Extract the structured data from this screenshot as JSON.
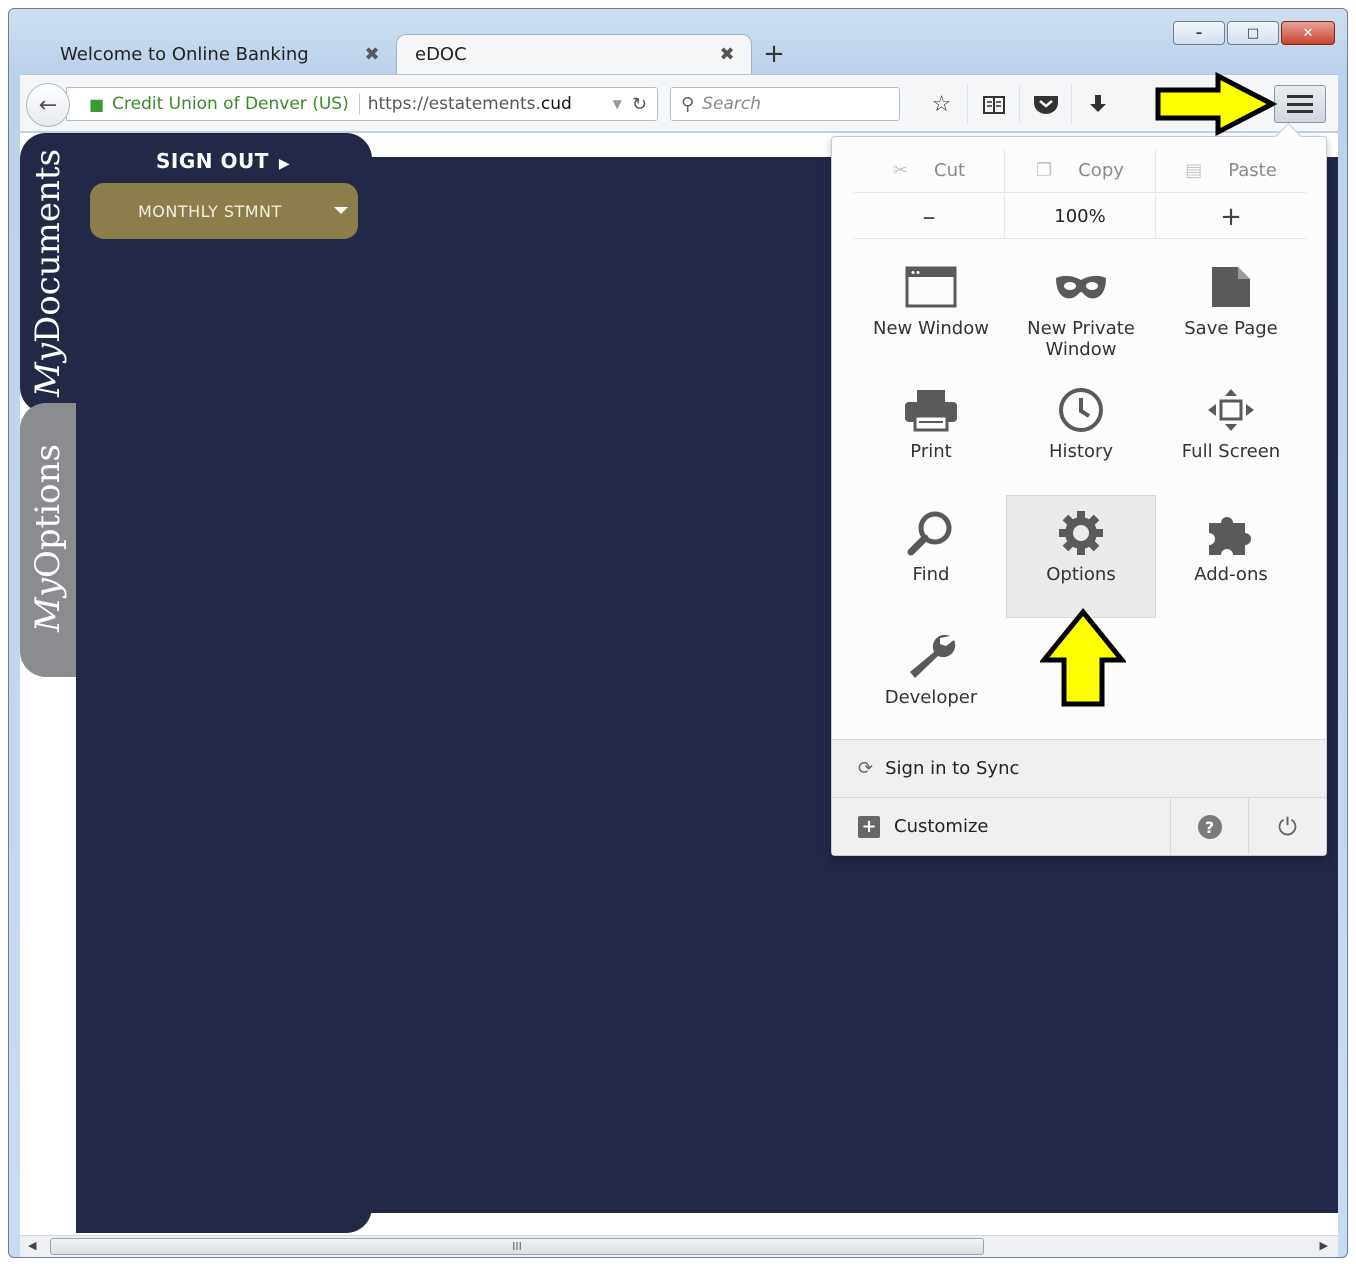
{
  "window": {
    "controls": {
      "minimize": "–",
      "maximize": "□",
      "close": "✕"
    }
  },
  "tabs": [
    {
      "title": "Welcome to Online Banking",
      "close": "✖",
      "active": false
    },
    {
      "title": "eDOC",
      "close": "✖",
      "active": true
    }
  ],
  "new_tab_label": "+",
  "navbar": {
    "back": "←",
    "identity": "Credit Union of Denver (US)",
    "url_prefix": "https://estatements.",
    "url_domain": "cud",
    "reload": "↻",
    "search_placeholder": "Search",
    "toolbar": [
      "star-icon",
      "reading-list-icon",
      "pocket-icon",
      "download-icon"
    ]
  },
  "sidebar": {
    "sign_out": "SIGN OUT",
    "statement_select": "MONTHLY STMNT",
    "tabs": [
      {
        "script": "My",
        "label": "Documents"
      },
      {
        "script": "My",
        "label": "Options"
      }
    ]
  },
  "menu_panel": {
    "edit": {
      "cut": "Cut",
      "copy": "Copy",
      "paste": "Paste"
    },
    "zoom": {
      "minus": "–",
      "value": "100%",
      "plus": "+"
    },
    "items": [
      {
        "label": "New Window",
        "icon": "new-window-icon"
      },
      {
        "label": "New Private Window",
        "icon": "private-mask-icon"
      },
      {
        "label": "Save Page",
        "icon": "save-page-icon"
      },
      {
        "label": "Print",
        "icon": "printer-icon"
      },
      {
        "label": "History",
        "icon": "clock-icon"
      },
      {
        "label": "Full Screen",
        "icon": "fullscreen-icon"
      },
      {
        "label": "Find",
        "icon": "magnifier-icon"
      },
      {
        "label": "Options",
        "icon": "gear-icon"
      },
      {
        "label": "Add-ons",
        "icon": "puzzle-icon"
      },
      {
        "label": "Developer",
        "icon": "wrench-icon"
      }
    ],
    "sync": "Sign in to Sync",
    "customize": "Customize"
  },
  "scrollbar": {
    "thumb_grip": "III"
  },
  "colors": {
    "navy": "#222845",
    "gold": "#8b7e4b",
    "arrow_yellow": "#ffff00",
    "identity_green": "#3b8a2a"
  }
}
